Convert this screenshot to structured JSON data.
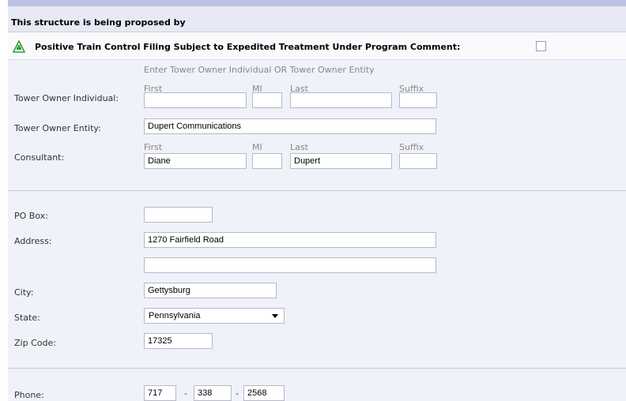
{
  "header": {
    "title": "This structure is being proposed by"
  },
  "ptc": {
    "label": "Positive Train Control Filing Subject to Expedited Treatment Under Program Comment:",
    "checked": false,
    "icon": "warning-triangle-icon",
    "icon_color": "#2e9e3a"
  },
  "owner": {
    "hint": "Enter Tower Owner Individual OR Tower Owner Entity",
    "individual_label": "Tower Owner Individual:",
    "first_label": "First",
    "mi_label": "MI",
    "last_label": "Last",
    "suffix_label": "Suffix",
    "first": "",
    "mi": "",
    "last": "",
    "suffix": "",
    "entity_label": "Tower Owner Entity:",
    "entity": "Dupert Communications"
  },
  "consultant": {
    "label": "Consultant:",
    "first_label": "First",
    "mi_label": "MI",
    "last_label": "Last",
    "suffix_label": "Suffix",
    "first": "Diane",
    "mi": "",
    "last": "Dupert",
    "suffix": ""
  },
  "address": {
    "po_box_label": "PO Box:",
    "po_box": "",
    "address_label": "Address:",
    "line1": "1270 Fairfield Road",
    "line2": "",
    "city_label": "City:",
    "city": "Gettysburg",
    "state_label": "State:",
    "state": "Pennsylvania",
    "zip_label": "Zip Code:",
    "zip": "17325"
  },
  "contact": {
    "phone_label": "Phone:",
    "area": "717",
    "prefix": "338",
    "line": "2568",
    "separator": "-"
  },
  "colors": {
    "header_bg": "#e8e9f5",
    "page_bg": "#f0f2f9",
    "top_strip": "#bcc2e3"
  }
}
